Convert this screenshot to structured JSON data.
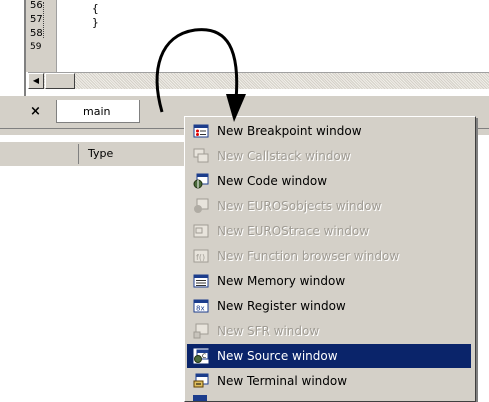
{
  "editor": {
    "line_numbers": [
      "56",
      "57",
      "58",
      "59"
    ],
    "code_lines": [
      "{",
      "}"
    ]
  },
  "tabs": {
    "close_glyph": "×",
    "active": "main"
  },
  "panel": {
    "column_header": "Type"
  },
  "menu": {
    "items": [
      {
        "label": "New Breakpoint window",
        "icon": "breakpoint-window-icon",
        "enabled": true,
        "selected": false
      },
      {
        "label": "New Callstack  window",
        "icon": "callstack-window-icon",
        "enabled": false,
        "selected": false
      },
      {
        "label": "New Code window",
        "icon": "code-window-icon",
        "enabled": true,
        "selected": false
      },
      {
        "label": "New EUROSobjects window",
        "icon": "eurosobjects-window-icon",
        "enabled": false,
        "selected": false
      },
      {
        "label": "New EUROStrace window",
        "icon": "eurostrace-window-icon",
        "enabled": false,
        "selected": false
      },
      {
        "label": "New Function browser window",
        "icon": "function-browser-icon",
        "enabled": false,
        "selected": false
      },
      {
        "label": "New Memory window",
        "icon": "memory-window-icon",
        "enabled": true,
        "selected": false
      },
      {
        "label": "New Register window",
        "icon": "register-window-icon",
        "enabled": true,
        "selected": false
      },
      {
        "label": "New SFR window",
        "icon": "sfr-window-icon",
        "enabled": false,
        "selected": false
      },
      {
        "label": "New Source window",
        "icon": "source-window-icon",
        "enabled": true,
        "selected": true
      },
      {
        "label": "New Terminal window",
        "icon": "terminal-window-icon",
        "enabled": true,
        "selected": false
      }
    ]
  },
  "colors": {
    "menu_bg": "#d4d0c8",
    "selection": "#0a246a",
    "disabled_text": "#a09c94"
  }
}
